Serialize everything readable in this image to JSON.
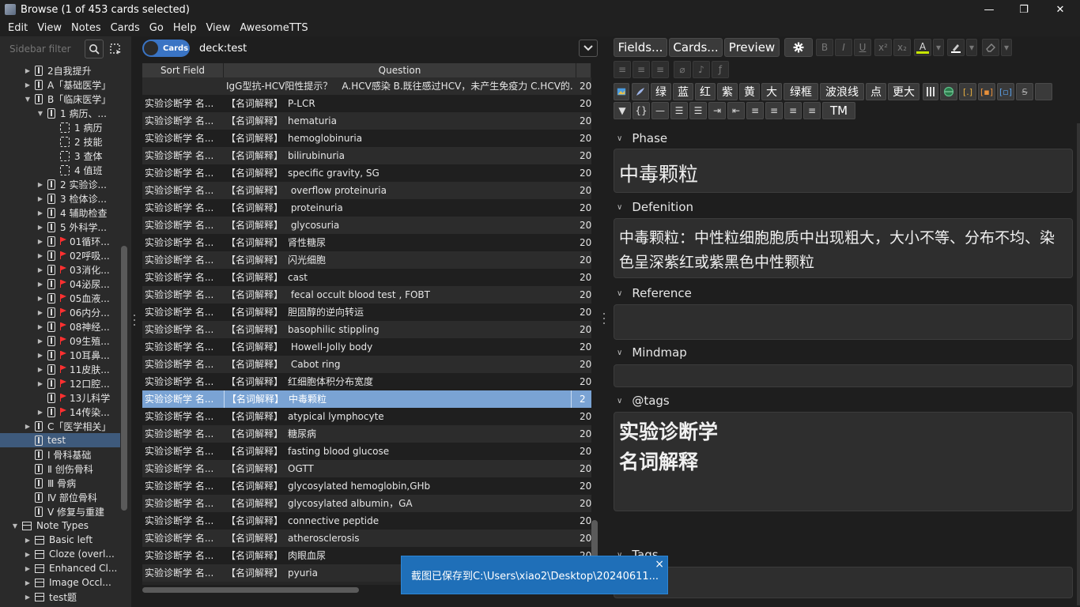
{
  "window": {
    "title": "Browse (1 of 453 cards selected)",
    "controls": [
      "—",
      "❐",
      "✕"
    ]
  },
  "menu": [
    "Edit",
    "View",
    "Notes",
    "Cards",
    "Go",
    "Help",
    "View",
    "AwesomeTTS"
  ],
  "sidebar": {
    "filter_placeholder": "Sidebar filter",
    "items": [
      {
        "label": "2自我提升",
        "indent": 1,
        "icon": "deck",
        "chev": "right"
      },
      {
        "label": "A「基础医学」",
        "indent": 1,
        "icon": "deck",
        "chev": "right"
      },
      {
        "label": "B「临床医学」",
        "indent": 1,
        "icon": "deck",
        "chev": "down"
      },
      {
        "label": "1 病历、...",
        "indent": 2,
        "icon": "deck",
        "chev": "down"
      },
      {
        "label": "1 病历",
        "indent": 3,
        "icon": "filtered",
        "chev": "none"
      },
      {
        "label": "2 技能",
        "indent": 3,
        "icon": "filtered",
        "chev": "none"
      },
      {
        "label": "3 查体",
        "indent": 3,
        "icon": "filtered",
        "chev": "none"
      },
      {
        "label": "4 值班",
        "indent": 3,
        "icon": "filtered",
        "chev": "none"
      },
      {
        "label": "2 实验诊...",
        "indent": 2,
        "icon": "deck",
        "chev": "right"
      },
      {
        "label": "3 检体诊...",
        "indent": 2,
        "icon": "deck",
        "chev": "right"
      },
      {
        "label": "4 辅助检查",
        "indent": 2,
        "icon": "deck",
        "chev": "right"
      },
      {
        "label": "5 外科学...",
        "indent": 2,
        "icon": "deck",
        "chev": "right"
      },
      {
        "label": "01循环...",
        "indent": 2,
        "icon": "deck",
        "chev": "right",
        "flag": true
      },
      {
        "label": "02呼吸...",
        "indent": 2,
        "icon": "deck",
        "chev": "right",
        "flag": true
      },
      {
        "label": "03消化...",
        "indent": 2,
        "icon": "deck",
        "chev": "right",
        "flag": true
      },
      {
        "label": "04泌尿...",
        "indent": 2,
        "icon": "deck",
        "chev": "right",
        "flag": true
      },
      {
        "label": "05血液...",
        "indent": 2,
        "icon": "deck",
        "chev": "right",
        "flag": true
      },
      {
        "label": "06内分...",
        "indent": 2,
        "icon": "deck",
        "chev": "right",
        "flag": true
      },
      {
        "label": "08神经...",
        "indent": 2,
        "icon": "deck",
        "chev": "right",
        "flag": true
      },
      {
        "label": "09生殖...",
        "indent": 2,
        "icon": "deck",
        "chev": "right",
        "flag": true
      },
      {
        "label": "10耳鼻...",
        "indent": 2,
        "icon": "deck",
        "chev": "right",
        "flag": true
      },
      {
        "label": "11皮肤...",
        "indent": 2,
        "icon": "deck",
        "chev": "right",
        "flag": true
      },
      {
        "label": "12口腔...",
        "indent": 2,
        "icon": "deck",
        "chev": "right",
        "flag": true
      },
      {
        "label": "13儿科学",
        "indent": 2,
        "icon": "deck",
        "chev": "none",
        "flag": true
      },
      {
        "label": "14传染...",
        "indent": 2,
        "icon": "deck",
        "chev": "right",
        "flag": true
      },
      {
        "label": "C「医学相关」",
        "indent": 1,
        "icon": "deck",
        "chev": "right"
      },
      {
        "label": "test",
        "indent": 1,
        "icon": "deck",
        "chev": "none",
        "selected": true
      },
      {
        "label": "Ⅰ 骨科基础",
        "indent": 1,
        "icon": "deck",
        "chev": "none"
      },
      {
        "label": "Ⅱ 创伤骨科",
        "indent": 1,
        "icon": "deck",
        "chev": "none"
      },
      {
        "label": "Ⅲ 骨病",
        "indent": 1,
        "icon": "deck",
        "chev": "none"
      },
      {
        "label": "Ⅳ 部位骨科",
        "indent": 1,
        "icon": "deck",
        "chev": "none"
      },
      {
        "label": "Ⅴ 修复与重建",
        "indent": 1,
        "icon": "deck",
        "chev": "none"
      },
      {
        "label": "Note Types",
        "indent": 0,
        "icon": "note",
        "chev": "down"
      },
      {
        "label": "Basic left",
        "indent": 1,
        "icon": "note",
        "chev": "right"
      },
      {
        "label": "Cloze (overl...",
        "indent": 1,
        "icon": "note",
        "chev": "right"
      },
      {
        "label": "Enhanced Cl...",
        "indent": 1,
        "icon": "note",
        "chev": "right"
      },
      {
        "label": "Image Occl...",
        "indent": 1,
        "icon": "note",
        "chev": "right"
      },
      {
        "label": "test题",
        "indent": 1,
        "icon": "note",
        "chev": "right"
      }
    ]
  },
  "browser": {
    "toggle_label": "Cards",
    "search_value": "deck:test",
    "columns": [
      "Sort Field",
      "Question"
    ],
    "rows": [
      {
        "sort": "",
        "question": "IgG型抗-HCV阳性提示？　A.HCV感染 B.既往感过HCV，未产生免疫力 C.HCV的...",
        "due": "20"
      },
      {
        "sort": "实验诊断学 名...",
        "question": "【名词解释】　P-LCR",
        "due": "20"
      },
      {
        "sort": "实验诊断学 名...",
        "question": "【名词解释】　hematuria",
        "due": "20"
      },
      {
        "sort": "实验诊断学 名...",
        "question": "【名词解释】　hemoglobinuria",
        "due": "20"
      },
      {
        "sort": "实验诊断学 名...",
        "question": "【名词解释】　bilirubinuria",
        "due": "20"
      },
      {
        "sort": "实验诊断学 名...",
        "question": "【名词解释】　specific gravity, SG",
        "due": "20"
      },
      {
        "sort": "实验诊断学 名...",
        "question": "【名词解释】　 overflow proteinuria",
        "due": "20"
      },
      {
        "sort": "实验诊断学 名...",
        "question": "【名词解释】　 proteinuria",
        "due": "20"
      },
      {
        "sort": "实验诊断学 名...",
        "question": "【名词解释】　 glycosuria",
        "due": "20"
      },
      {
        "sort": "实验诊断学 名...",
        "question": "【名词解释】　肾性糖尿",
        "due": "20"
      },
      {
        "sort": "实验诊断学 名...",
        "question": "【名词解释】　闪光细胞",
        "due": "20"
      },
      {
        "sort": "实验诊断学 名...",
        "question": "【名词解释】　cast",
        "due": "20"
      },
      {
        "sort": "实验诊断学 名...",
        "question": "【名词解释】　 fecal occult blood test , FOBT",
        "due": "20"
      },
      {
        "sort": "实验诊断学 名...",
        "question": "【名词解释】　胆固醇的逆向转运",
        "due": "20"
      },
      {
        "sort": "实验诊断学 名...",
        "question": "【名词解释】　basophilic stippling",
        "due": "20"
      },
      {
        "sort": "实验诊断学 名...",
        "question": "【名词解释】　 Howell-Jolly body",
        "due": "20"
      },
      {
        "sort": "实验诊断学 名...",
        "question": "【名词解释】　 Cabot ring",
        "due": "20"
      },
      {
        "sort": "实验诊断学 名...",
        "question": "【名词解释】　红细胞体积分布宽度",
        "due": "20"
      },
      {
        "sort": "实验诊断学 名...",
        "question": "【名词解释】　中毒颗粒",
        "due": "2",
        "selected": true
      },
      {
        "sort": "实验诊断学 名...",
        "question": "【名词解释】　atypical lymphocyte",
        "due": "20"
      },
      {
        "sort": "实验诊断学 名...",
        "question": "【名词解释】　糖尿病",
        "due": "20"
      },
      {
        "sort": "实验诊断学 名...",
        "question": "【名词解释】　fasting blood glucose",
        "due": "20"
      },
      {
        "sort": "实验诊断学 名...",
        "question": "【名词解释】　OGTT",
        "due": "20"
      },
      {
        "sort": "实验诊断学 名...",
        "question": "【名词解释】　glycosylated hemoglobin,GHb",
        "due": "20"
      },
      {
        "sort": "实验诊断学 名...",
        "question": "【名词解释】　glycosylated albumin，GA",
        "due": "20"
      },
      {
        "sort": "实验诊断学 名...",
        "question": "【名词解释】　connective peptide",
        "due": "20"
      },
      {
        "sort": "实验诊断学 名...",
        "question": "【名词解释】　atherosclerosis",
        "due": "20"
      },
      {
        "sort": "实验诊断学 名...",
        "question": "【名词解释】　肉眼血尿",
        "due": "20"
      },
      {
        "sort": "实验诊断学 名...",
        "question": "【名词解释】　pyuria",
        "due": "20"
      }
    ]
  },
  "toast": {
    "message": "截图已保存到C:\\Users\\xiao2\\Desktop\\20240611...",
    "close": "×"
  },
  "editor": {
    "toolbar": {
      "fields_label": "Fields...",
      "cards_label": "Cards...",
      "preview_label": "Preview"
    },
    "format_buttons": [
      "B",
      "I",
      "U",
      "x²",
      "x₂"
    ],
    "color_buttons": [
      "绿",
      "蓝",
      "红",
      "紫",
      "黄",
      "大",
      "绿框",
      "波浪线",
      "点",
      "更大"
    ],
    "misc_buttons": [
      "▼",
      "{}",
      "—",
      "TM"
    ],
    "text_color": "#c8e600",
    "fields": [
      {
        "name": "Phase",
        "value": "中毒颗粒"
      },
      {
        "name": "Defenition",
        "value": "中毒颗粒：中性粒细胞胞质中出现粗大，大小不等、分布不均、染色呈深紫红或紫黑色中性颗粒"
      },
      {
        "name": "Reference",
        "value": ""
      },
      {
        "name": "Mindmap",
        "value": ""
      },
      {
        "name": "@tags",
        "value_lines": [
          "实验诊断学",
          "名词解释"
        ]
      },
      {
        "name": "Tags",
        "value": ""
      }
    ]
  }
}
